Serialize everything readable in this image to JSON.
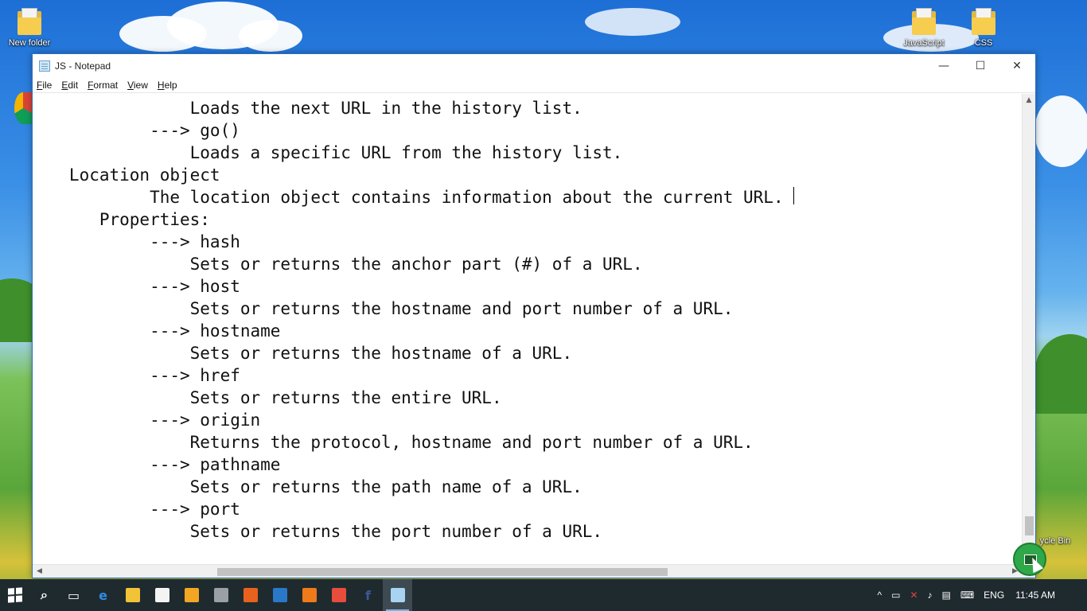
{
  "desktop": {
    "icons": [
      {
        "label": "New folder"
      },
      {
        "label": "JavaScript"
      },
      {
        "label": "CSS"
      },
      {
        "label": "ycle Bin"
      }
    ]
  },
  "window": {
    "title": "JS - Notepad",
    "menu": [
      {
        "underline": "F",
        "rest": "ile"
      },
      {
        "underline": "E",
        "rest": "dit"
      },
      {
        "underline": "F",
        "rest": "ormat"
      },
      {
        "underline": "V",
        "rest": "iew"
      },
      {
        "underline": "H",
        "rest": "elp"
      }
    ],
    "controls": {
      "minimize": "—",
      "maximize": "☐",
      "close": "✕"
    }
  },
  "editor": {
    "lines": [
      "               Loads the next URL in the history list.",
      "           ---> go()",
      "               Loads a specific URL from the history list.",
      "   Location object",
      "           The location object contains information about the current URL.",
      "      Properties:",
      "           ---> hash",
      "               Sets or returns the anchor part (#) of a URL.",
      "           ---> host",
      "               Sets or returns the hostname and port number of a URL.",
      "           ---> hostname",
      "               Sets or returns the hostname of a URL.",
      "           ---> href",
      "               Sets or returns the entire URL.",
      "           ---> origin",
      "               Returns the protocol, hostname and port number of a URL.",
      "           ---> pathname",
      "               Sets or returns the path name of a URL.",
      "           ---> port",
      "               Sets or returns the port number of a URL."
    ]
  },
  "taskbar": {
    "pinned": [
      {
        "name": "search-icon",
        "glyph": "⌕",
        "color": "#ffffff"
      },
      {
        "name": "task-view-icon",
        "glyph": "▭",
        "color": "#ffffff"
      },
      {
        "name": "edge-icon",
        "glyph": "e",
        "color": "#2f8be6"
      },
      {
        "name": "file-explorer-icon",
        "glyph": "",
        "color": "#f2c237"
      },
      {
        "name": "store-icon",
        "glyph": "",
        "color": "#f4f4f4"
      },
      {
        "name": "media-player-icon",
        "glyph": "",
        "color": "#f2a623"
      },
      {
        "name": "film-icon",
        "glyph": "",
        "color": "#9aa0a4"
      },
      {
        "name": "firefox-icon",
        "glyph": "",
        "color": "#e8621e"
      },
      {
        "name": "news-icon",
        "glyph": "",
        "color": "#2a78c8"
      },
      {
        "name": "paint-icon",
        "glyph": "",
        "color": "#ef7a1a"
      },
      {
        "name": "chrome-icon",
        "glyph": "",
        "color": "#e84c3d"
      },
      {
        "name": "facebook-icon",
        "glyph": "f",
        "color": "#3b5998"
      },
      {
        "name": "notepad-icon",
        "glyph": "",
        "color": "#a8d4f2"
      }
    ],
    "tray": {
      "chevron": "^",
      "lang": "ENG",
      "time": "11:45 AM"
    }
  }
}
